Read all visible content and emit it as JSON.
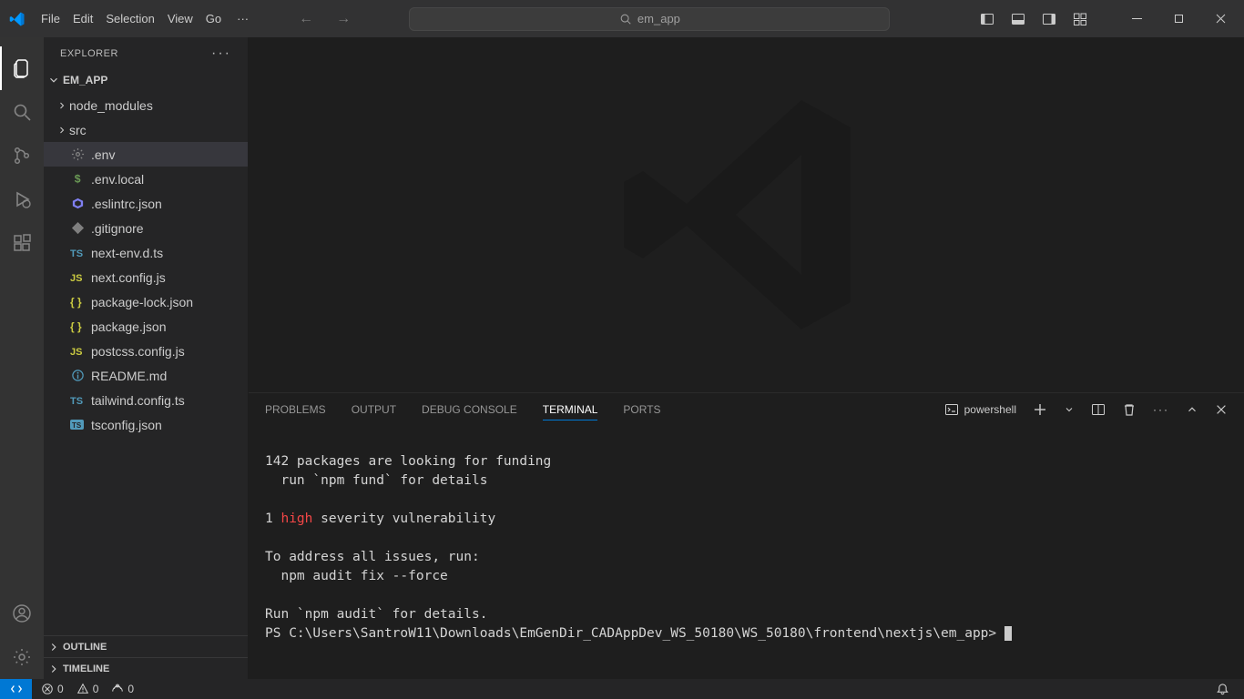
{
  "menu": {
    "file": "File",
    "edit": "Edit",
    "selection": "Selection",
    "view": "View",
    "go": "Go"
  },
  "search_label": "em_app",
  "explorer": {
    "title": "EXPLORER",
    "folder": "EM_APP",
    "tree": [
      {
        "type": "folder",
        "label": "node_modules"
      },
      {
        "type": "folder",
        "label": "src"
      },
      {
        "type": "file",
        "label": ".env",
        "icon": "gear",
        "iconColor": "#858585",
        "selected": true
      },
      {
        "type": "file",
        "label": ".env.local",
        "icon": "dollar",
        "iconColor": "#6a9955"
      },
      {
        "type": "file",
        "label": ".eslintrc.json",
        "icon": "eslint",
        "iconColor": "#8080f2"
      },
      {
        "type": "file",
        "label": ".gitignore",
        "icon": "git",
        "iconColor": "#8f8f8f"
      },
      {
        "type": "file",
        "label": "next-env.d.ts",
        "icon": "ts",
        "iconColor": "#519aba"
      },
      {
        "type": "file",
        "label": "next.config.js",
        "icon": "js",
        "iconColor": "#cbcb41"
      },
      {
        "type": "file",
        "label": "package-lock.json",
        "icon": "braces",
        "iconColor": "#cbcb41"
      },
      {
        "type": "file",
        "label": "package.json",
        "icon": "braces",
        "iconColor": "#cbcb41"
      },
      {
        "type": "file",
        "label": "postcss.config.js",
        "icon": "js",
        "iconColor": "#cbcb41"
      },
      {
        "type": "file",
        "label": "README.md",
        "icon": "info",
        "iconColor": "#519aba"
      },
      {
        "type": "file",
        "label": "tailwind.config.ts",
        "icon": "ts",
        "iconColor": "#519aba"
      },
      {
        "type": "file",
        "label": "tsconfig.json",
        "icon": "tsjson",
        "iconColor": "#519aba"
      }
    ],
    "outline": "OUTLINE",
    "timeline": "TIMELINE"
  },
  "panel": {
    "tabs": {
      "problems": "PROBLEMS",
      "output": "OUTPUT",
      "debug": "DEBUG CONSOLE",
      "terminal": "TERMINAL",
      "ports": "PORTS"
    },
    "shell": "powershell"
  },
  "terminal": {
    "line1": "142 packages are looking for funding",
    "line2": "  run `npm fund` for details",
    "line3a": "1 ",
    "line3b": "high",
    "line3c": " severity vulnerability",
    "line4": "To address all issues, run:",
    "line5": "  npm audit fix --force",
    "line6": "Run `npm audit` for details.",
    "prompt": "PS C:\\Users\\SantroW11\\Downloads\\EmGenDir_CADAppDev_WS_50180\\WS_50180\\frontend\\nextjs\\em_app> "
  },
  "status": {
    "errors": "0",
    "warnings": "0",
    "ports": "0"
  }
}
